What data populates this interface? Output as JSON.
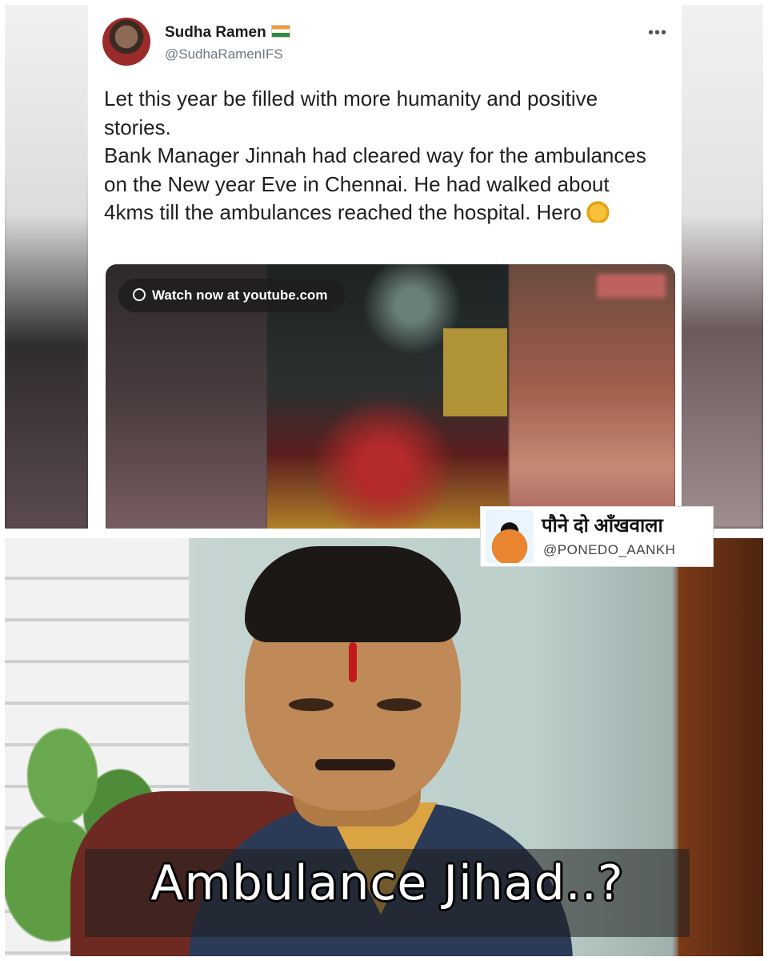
{
  "tweet": {
    "author_name": "Sudha Ramen",
    "author_flag": "flag-india-icon",
    "author_handle": "@SudhaRamenIFS",
    "more_icon": "more-options-icon",
    "text": "Let this year be filled with more humanity and positive stories.\nBank Manager Jinnah had cleared way for the ambulances on the New year Eve in Chennai. He had walked about 4kms till the ambulances reached the hospital. Hero",
    "emoji": "clapping-hands-icon",
    "video": {
      "watch_label": "Watch now at youtube.com",
      "link_icon": "link-icon"
    }
  },
  "watermark": {
    "title": "पौने दो आँखवाला",
    "handle": "@PONEDO_AANKH",
    "logo": "ponedo-aankh-logo"
  },
  "meme": {
    "caption": "Ambulance Jihad..?"
  }
}
